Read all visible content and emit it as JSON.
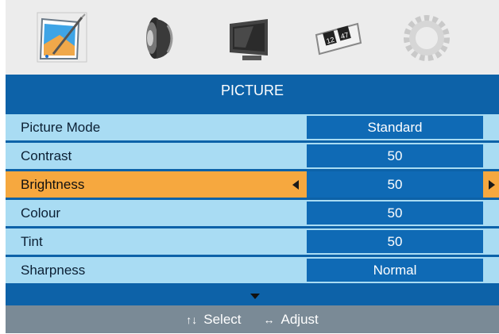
{
  "menu": {
    "tabs": [
      {
        "name": "picture-tab",
        "icon": "picture-icon",
        "selected": true
      },
      {
        "name": "sound-tab",
        "icon": "speaker-icon",
        "selected": false
      },
      {
        "name": "screen-tab",
        "icon": "monitor-icon",
        "selected": false
      },
      {
        "name": "time-tab",
        "icon": "clock-icon",
        "selected": false
      },
      {
        "name": "setup-tab",
        "icon": "gear-icon",
        "selected": false
      }
    ],
    "title": "PICTURE",
    "items": [
      {
        "label": "Picture Mode",
        "value": "Standard"
      },
      {
        "label": "Contrast",
        "value": "50"
      },
      {
        "label": "Brightness",
        "value": "50"
      },
      {
        "label": "Colour",
        "value": "50"
      },
      {
        "label": "Tint",
        "value": "50"
      },
      {
        "label": "Sharpness",
        "value": "Normal"
      }
    ],
    "selected_index": 2
  },
  "footer": {
    "select_glyph": "↑↓",
    "select_label": "Select",
    "adjust_glyph": "↔",
    "adjust_label": "Adjust"
  },
  "colors": {
    "title_bar": "#0d62a8",
    "row_bg": "#a9dcf3",
    "value_bg": "#0f6ab5",
    "highlight": "#f6a83f",
    "hint_bar": "#7a8a96"
  }
}
